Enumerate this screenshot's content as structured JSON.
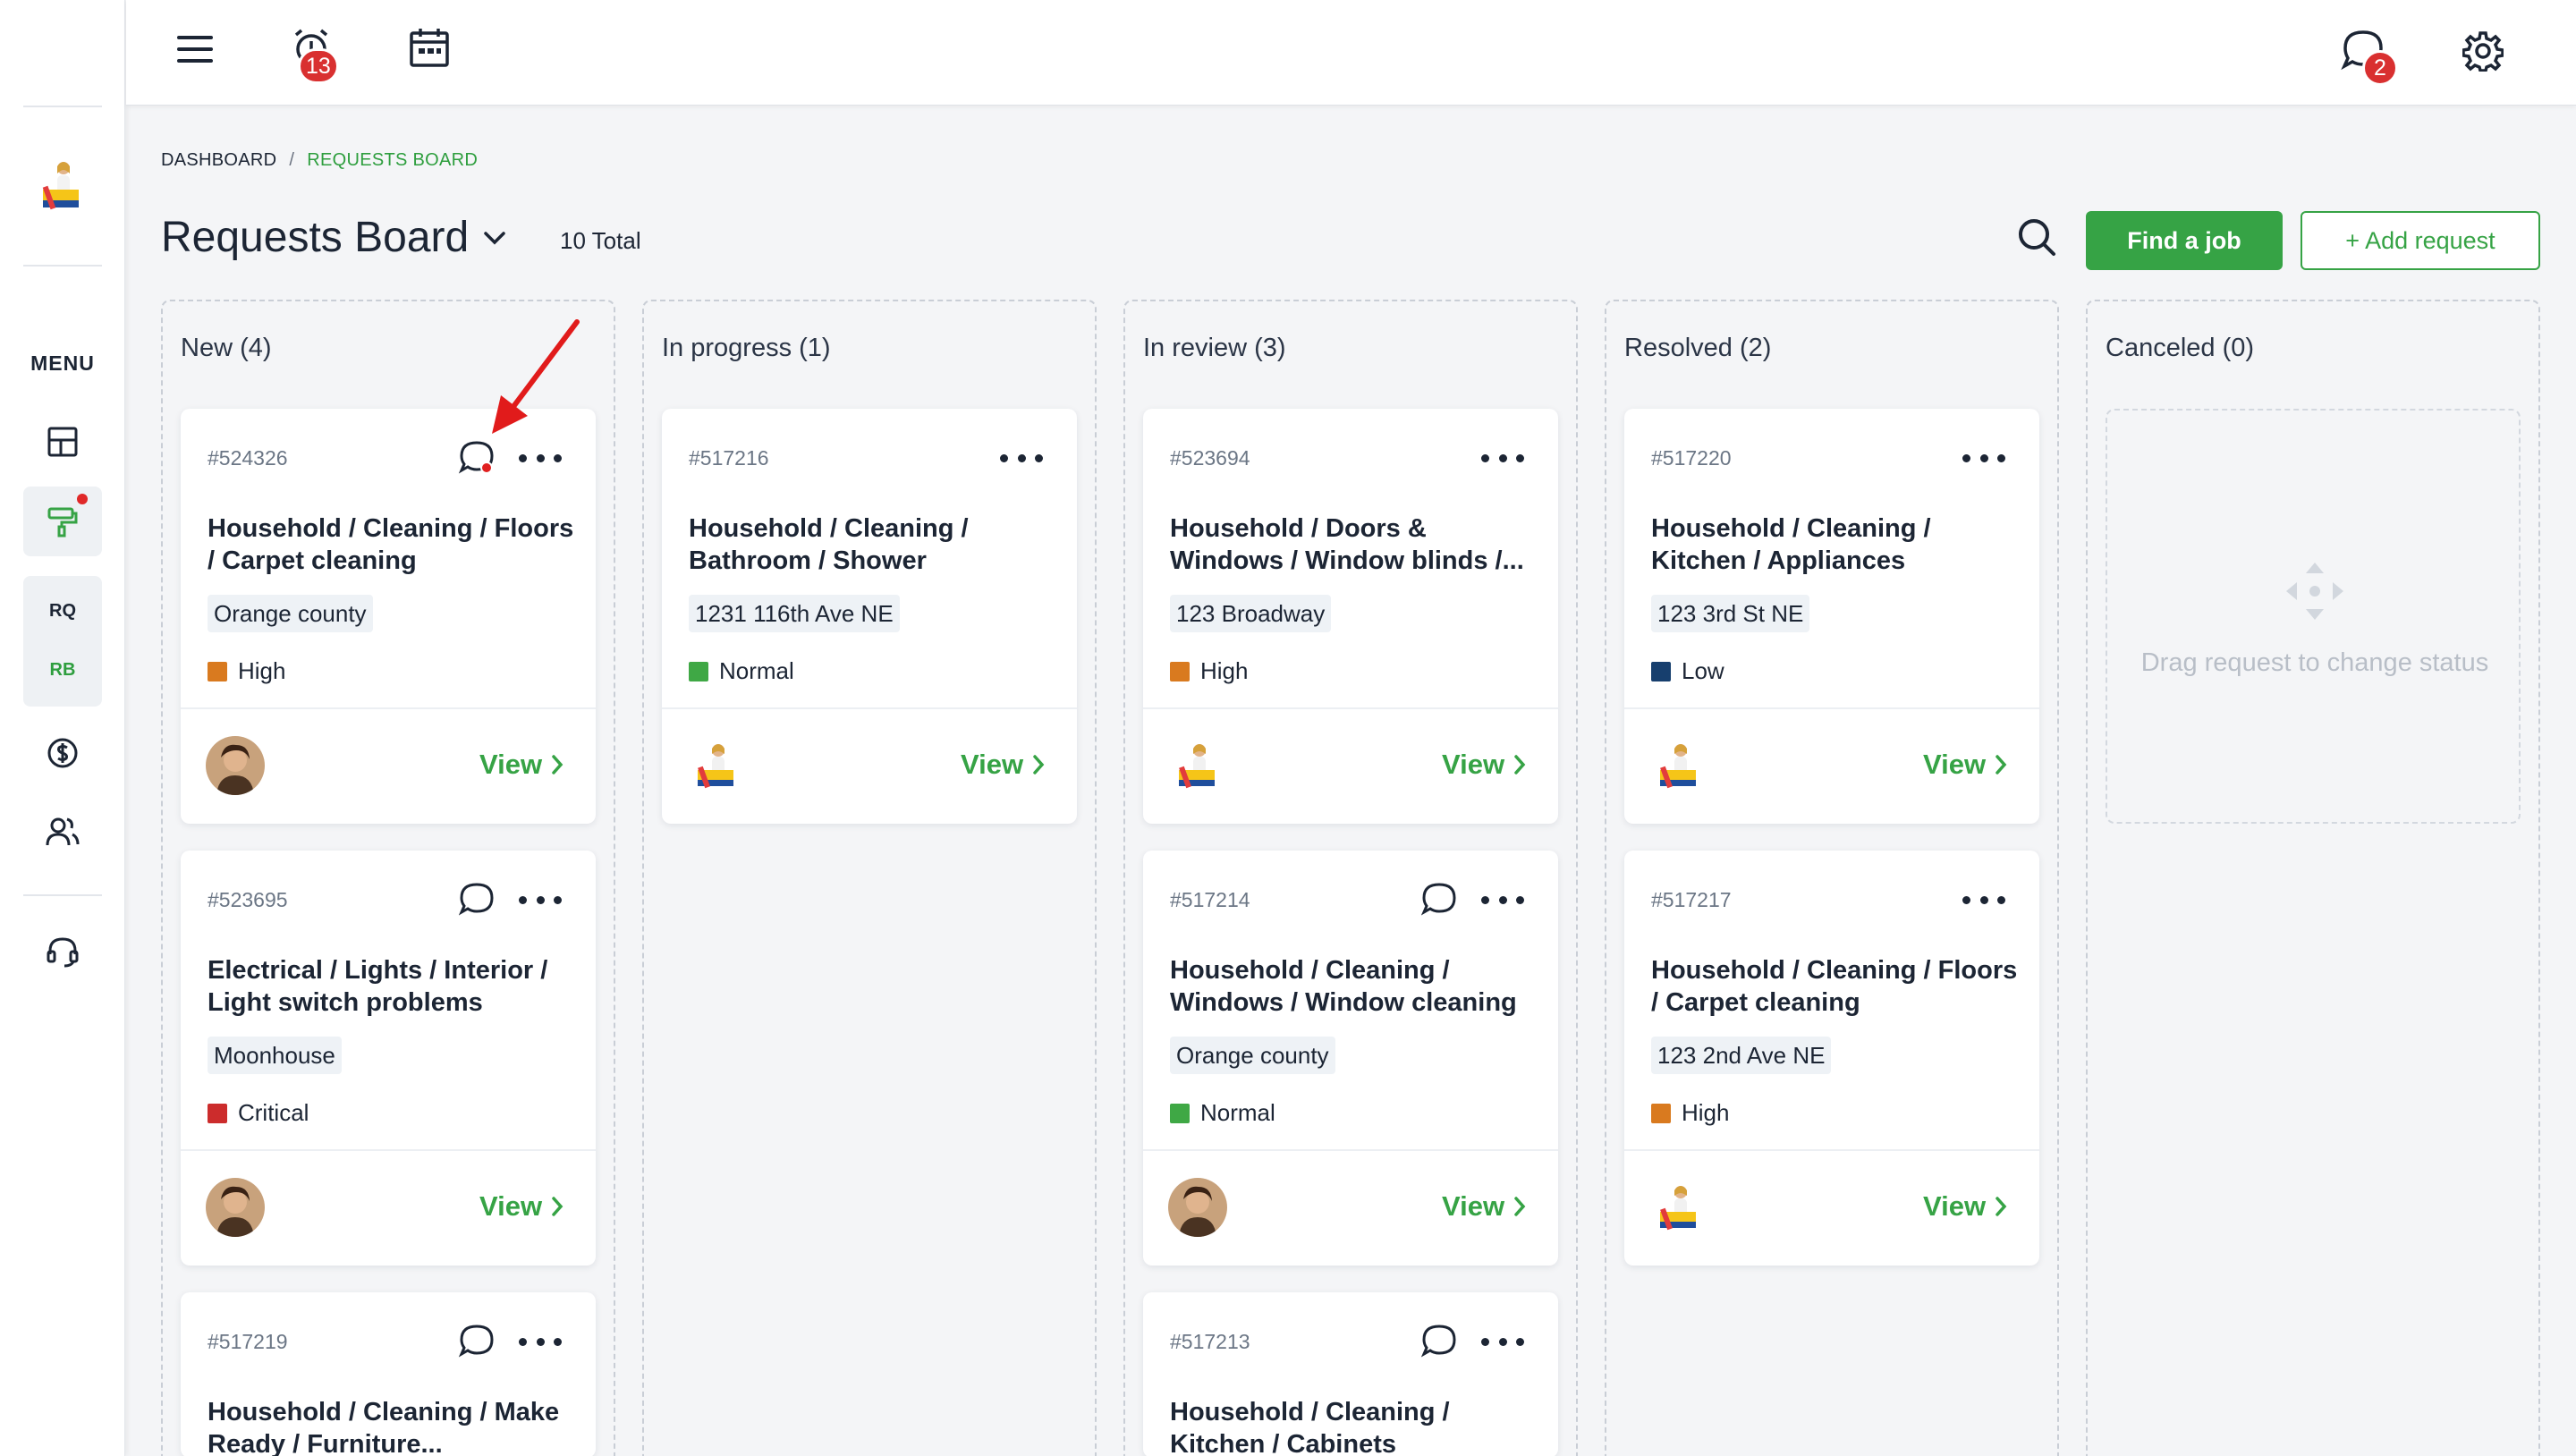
{
  "sidebar": {
    "menu_label": "MENU",
    "sub_items": [
      "RQ",
      "RB"
    ],
    "icons": [
      "dashboard-icon",
      "paint-roller-icon",
      "dollar-icon",
      "users-icon",
      "headset-icon"
    ]
  },
  "topbar": {
    "reminders_badge": "13",
    "messages_badge": "2",
    "icons": [
      "hamburger-menu-icon",
      "alarm-clock-icon",
      "calendar-icon",
      "chat-icon",
      "gear-icon"
    ]
  },
  "breadcrumb": {
    "parent": "DASHBOARD",
    "separator": "/",
    "current": "REQUESTS BOARD"
  },
  "header": {
    "title": "Requests Board",
    "total": "10 Total",
    "find_job_label": "Find a job",
    "add_request_label": "+ Add request"
  },
  "colors": {
    "accent": "#36a345",
    "high": "#d97a1f",
    "normal": "#3fa845",
    "low": "#173f6e",
    "critical": "#cc2c2c",
    "badge": "#d93030"
  },
  "columns": [
    {
      "title": "New (4)",
      "cards": [
        {
          "id": "#524326",
          "title": "Household / Cleaning / Floors / Carpet cleaning",
          "location": "Orange county",
          "priority": "High",
          "priority_color": "#d97a1f",
          "chat": true,
          "chat_unread": true,
          "avatar": "man",
          "view": "View"
        },
        {
          "id": "#523695",
          "title": "Electrical / Lights / Interior / Light switch problems",
          "location": "Moonhouse",
          "priority": "Critical",
          "priority_color": "#cc2c2c",
          "chat": true,
          "chat_unread": false,
          "avatar": "man",
          "view": "View"
        },
        {
          "id": "#517219",
          "title": "Household / Cleaning / Make Ready / Furniture...",
          "location": "",
          "priority": "",
          "priority_color": "",
          "chat": true,
          "chat_unread": false,
          "avatar": "",
          "view": ""
        }
      ]
    },
    {
      "title": "In progress (1)",
      "cards": [
        {
          "id": "#517216",
          "title": "Household / Cleaning / Bathroom / Shower",
          "location": "1231 116th Ave NE",
          "priority": "Normal",
          "priority_color": "#3fa845",
          "chat": false,
          "chat_unread": false,
          "avatar": "worker",
          "view": "View"
        }
      ]
    },
    {
      "title": "In review (3)",
      "cards": [
        {
          "id": "#523694",
          "title": "Household / Doors & Windows / Window blinds /...",
          "location": "123 Broadway",
          "priority": "High",
          "priority_color": "#d97a1f",
          "chat": false,
          "chat_unread": false,
          "avatar": "worker",
          "view": "View"
        },
        {
          "id": "#517214",
          "title": "Household / Cleaning / Windows / Window cleaning",
          "location": "Orange county",
          "priority": "Normal",
          "priority_color": "#3fa845",
          "chat": true,
          "chat_unread": false,
          "avatar": "man",
          "view": "View"
        },
        {
          "id": "#517213",
          "title": "Household / Cleaning / Kitchen / Cabinets",
          "location": "",
          "priority": "",
          "priority_color": "",
          "chat": true,
          "chat_unread": false,
          "avatar": "",
          "view": ""
        }
      ]
    },
    {
      "title": "Resolved (2)",
      "cards": [
        {
          "id": "#517220",
          "title": "Household / Cleaning / Kitchen / Appliances",
          "location": "123 3rd St NE",
          "priority": "Low",
          "priority_color": "#173f6e",
          "chat": false,
          "chat_unread": false,
          "avatar": "worker",
          "view": "View"
        },
        {
          "id": "#517217",
          "title": "Household / Cleaning / Floors / Carpet cleaning",
          "location": "123 2nd Ave NE",
          "priority": "High",
          "priority_color": "#d97a1f",
          "chat": false,
          "chat_unread": false,
          "avatar": "worker",
          "view": "View"
        }
      ]
    },
    {
      "title": "Canceled (0)",
      "cards": [],
      "empty_text": "Drag request to change status"
    }
  ]
}
